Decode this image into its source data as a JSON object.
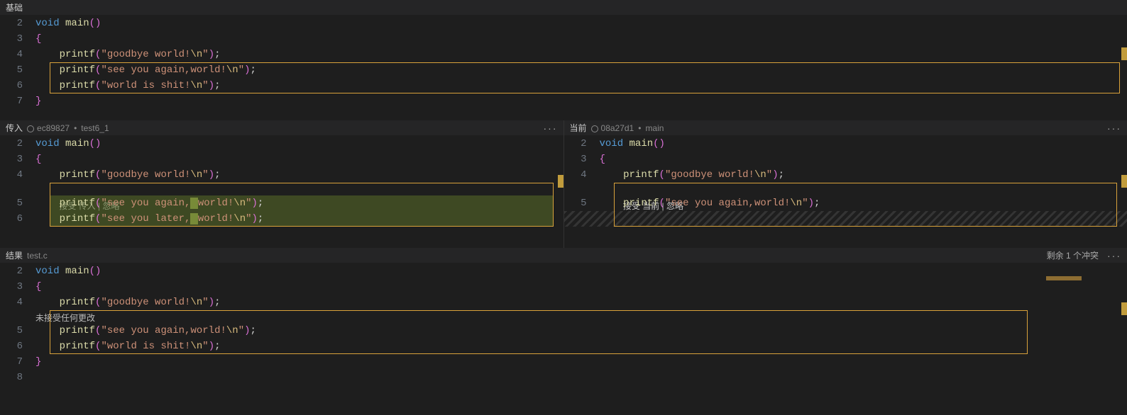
{
  "panes": {
    "base": {
      "title": "基础"
    },
    "incoming": {
      "title": "传入",
      "commit": "ec89827",
      "branch": "test6_1",
      "actions": {
        "accept": "接受 传入",
        "ignore": "忽略"
      }
    },
    "current": {
      "title": "当前",
      "commit": "08a27d1",
      "branch": "main",
      "actions": {
        "accept": "接受 当前",
        "ignore": "忽略"
      }
    },
    "result": {
      "title": "结果",
      "filename": "test.c",
      "remaining_label": "剩余 1 个冲突",
      "banner": "未接受任何更改"
    }
  },
  "code": {
    "void": "void",
    "main": "main",
    "printf": "printf",
    "lparen": "(",
    "rparen": ")",
    "lbrace": "{",
    "rbrace": "}",
    "semi": ";",
    "indent": "    ",
    "strings": {
      "goodbye": "\"goodbye world!",
      "see_again_nospace": "\"see you again,world!",
      "see_again_space": "\"see you again,",
      "see_again_space_tail": "world!",
      "see_later": "\"see you later,",
      "see_later_tail": "world!",
      "shit": "\"world is shit!",
      "esc": "\\n",
      "quote": "\""
    }
  },
  "lines": {
    "base": [
      "2",
      "3",
      "4",
      "5",
      "6",
      "7"
    ],
    "incoming": [
      "2",
      "3",
      "4",
      "5",
      "6"
    ],
    "current": [
      "2",
      "3",
      "4",
      "5"
    ],
    "result": [
      "2",
      "3",
      "4",
      "5",
      "6",
      "7",
      "8"
    ]
  }
}
